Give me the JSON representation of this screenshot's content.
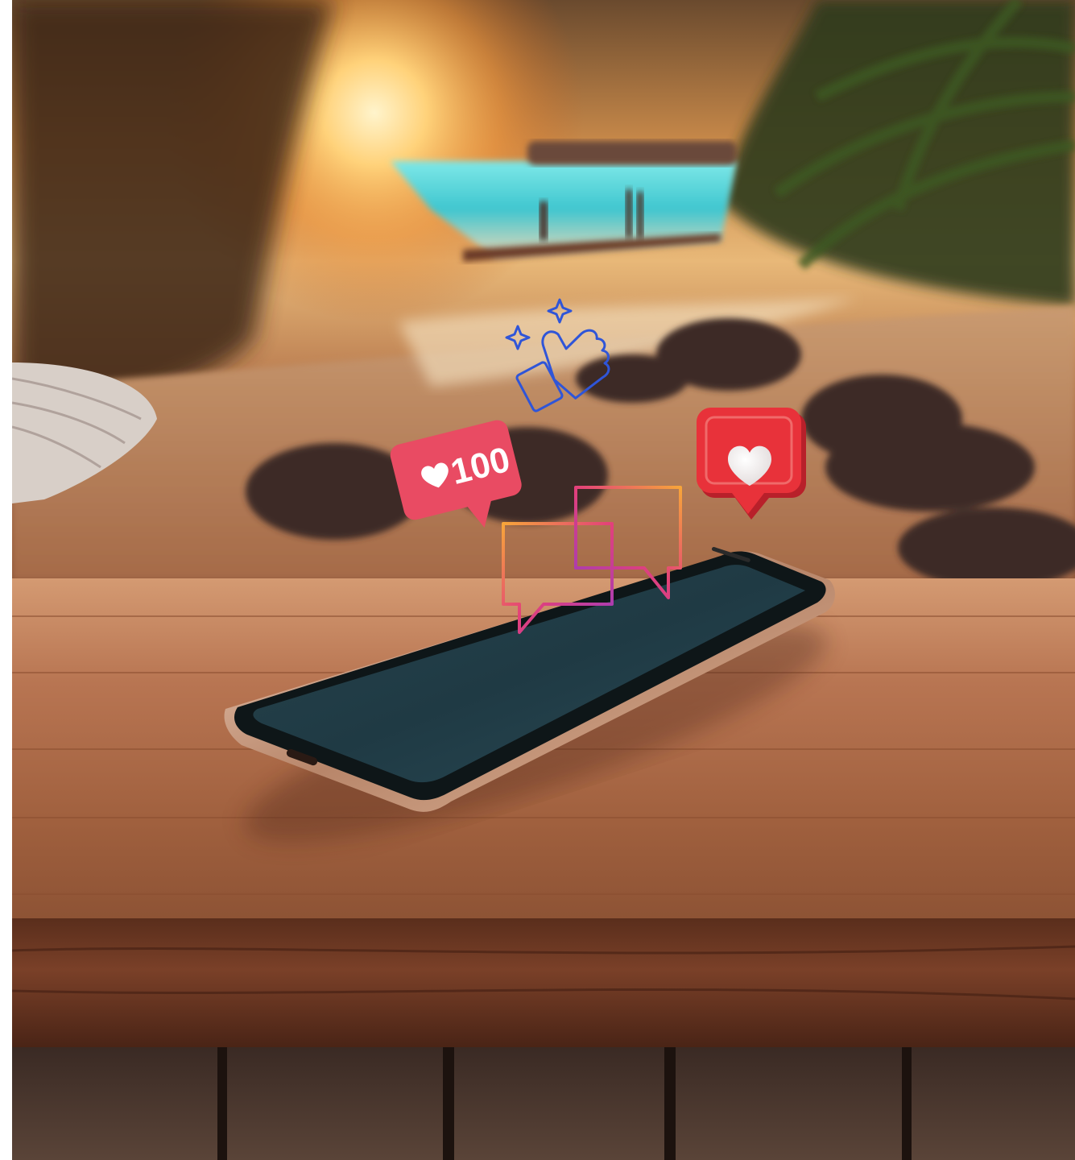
{
  "like_badge": {
    "count": "100",
    "icon": "heart-icon"
  },
  "icons": [
    "thumbs-up-icon",
    "sparkle-icon",
    "heart-icon",
    "chat-bubble-icon"
  ],
  "colors": {
    "badge_pink": "#e94b63",
    "notify_red": "#e8323a",
    "thumb_blue": "#2f55d8",
    "chat_orange": "#f08a2a",
    "chat_purple": "#b43ab0",
    "sunset_glow": "#ffc870",
    "sea_turquoise": "#3fd0d8",
    "wood_brown": "#8a5030"
  }
}
